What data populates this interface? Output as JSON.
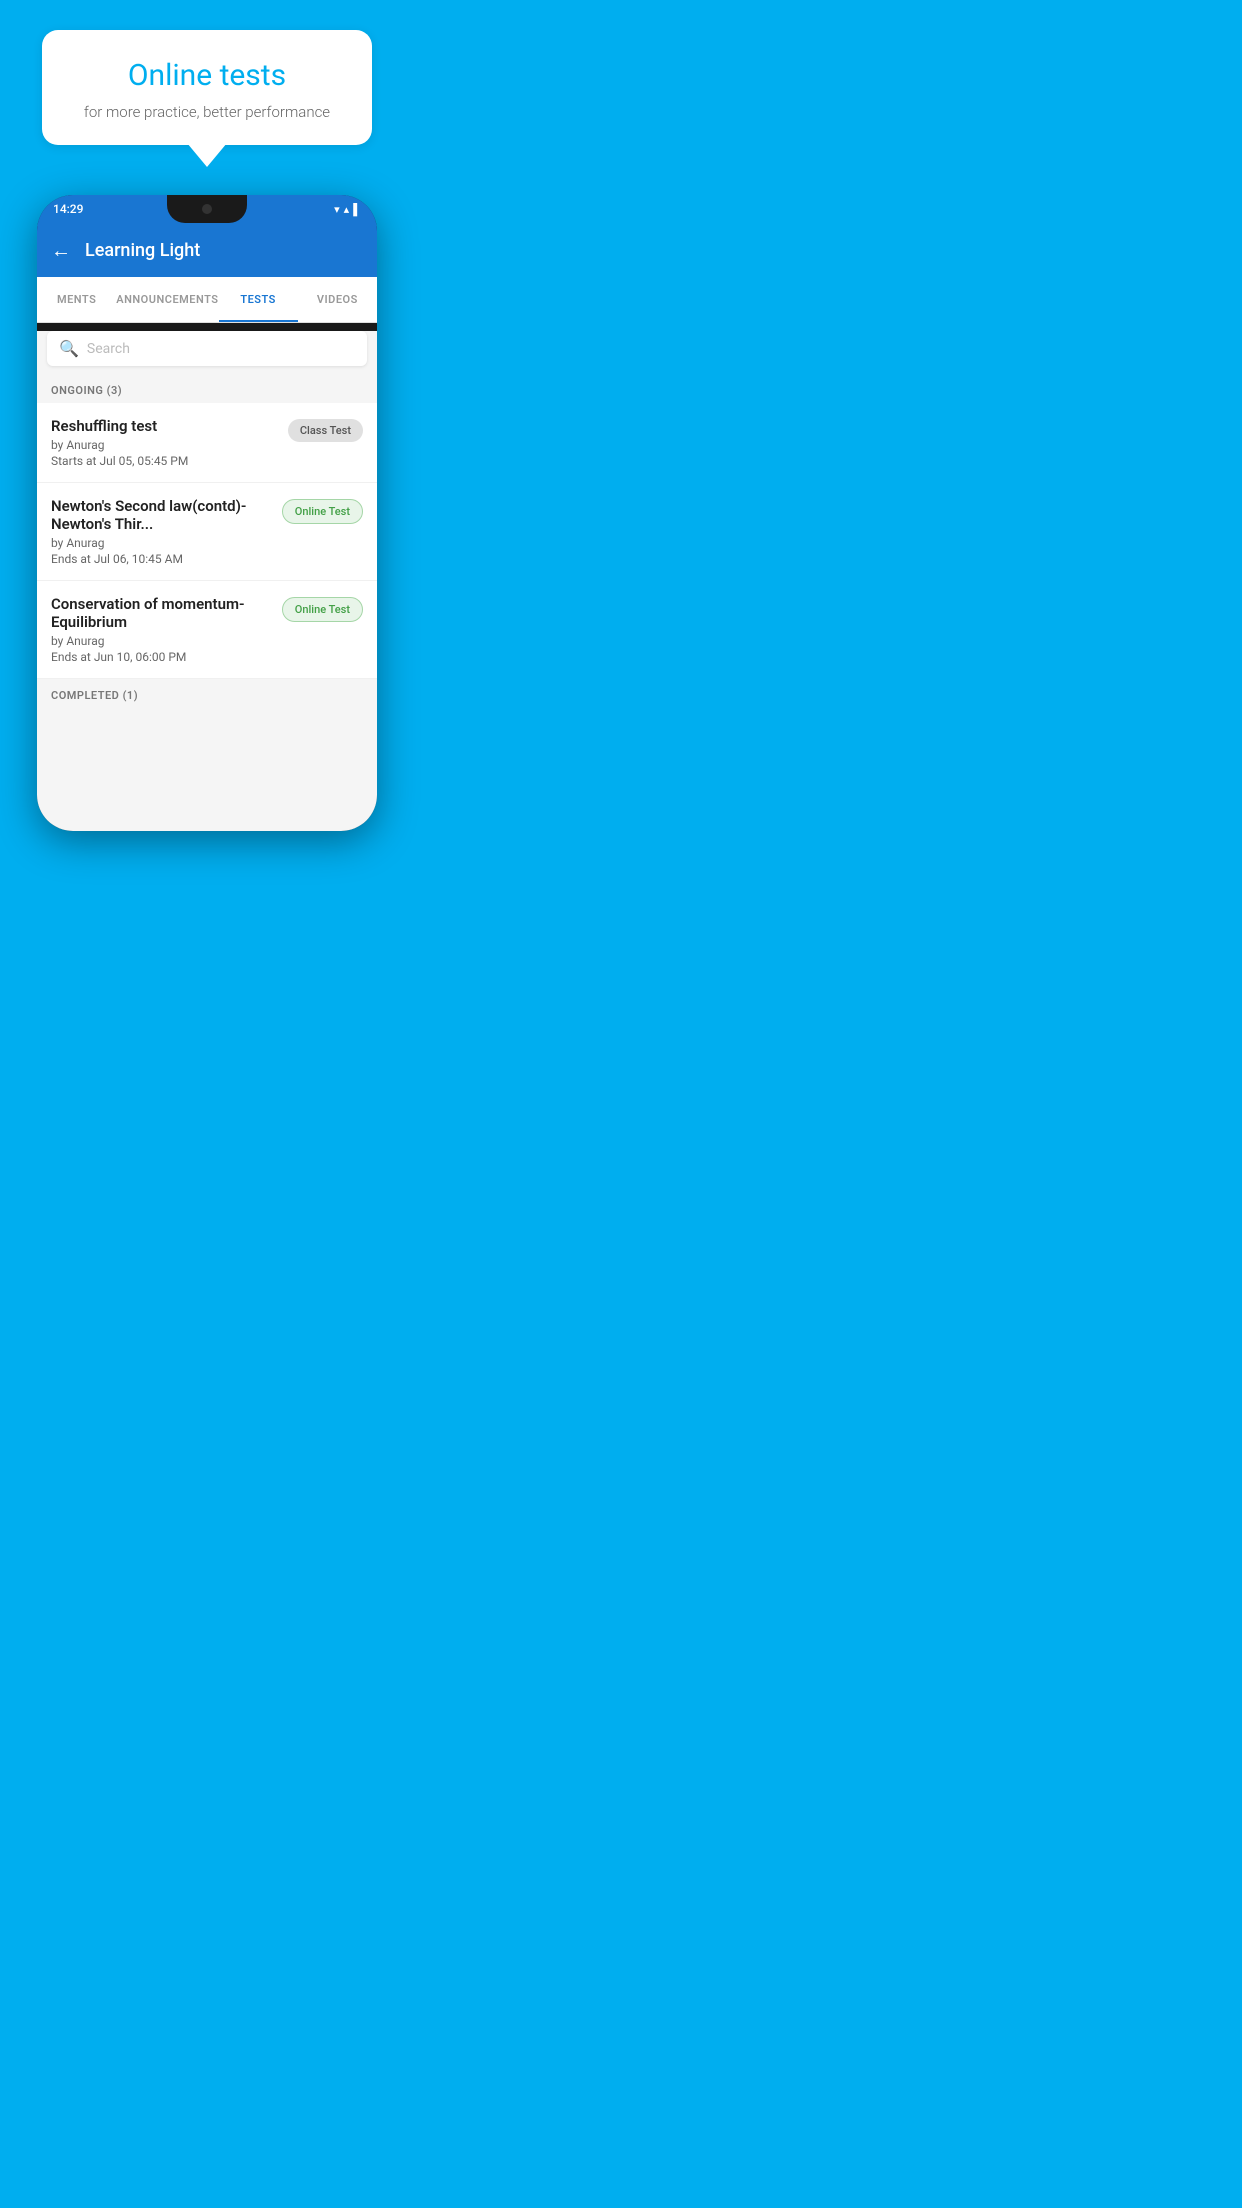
{
  "background": {
    "color": "#00AEEF"
  },
  "promo": {
    "title": "Online tests",
    "subtitle": "for more practice, better performance"
  },
  "phone": {
    "statusBar": {
      "time": "14:29",
      "icons": [
        "▼",
        "▲",
        "▌"
      ]
    },
    "appBar": {
      "title": "Learning Light",
      "backLabel": "←"
    },
    "tabs": [
      {
        "id": "ments",
        "label": "MENTS",
        "active": false
      },
      {
        "id": "announcements",
        "label": "ANNOUNCEMENTS",
        "active": false
      },
      {
        "id": "tests",
        "label": "TESTS",
        "active": true
      },
      {
        "id": "videos",
        "label": "VIDEOS",
        "active": false
      }
    ],
    "search": {
      "placeholder": "Search"
    },
    "ongoingSection": {
      "label": "ONGOING (3)"
    },
    "testItems": [
      {
        "id": "reshuffling",
        "name": "Reshuffling test",
        "by": "by Anurag",
        "date": "Starts at  Jul 05, 05:45 PM",
        "badgeLabel": "Class Test",
        "badgeType": "class"
      },
      {
        "id": "newtons-second",
        "name": "Newton's Second law(contd)-Newton's Thir...",
        "by": "by Anurag",
        "date": "Ends at  Jul 06, 10:45 AM",
        "badgeLabel": "Online Test",
        "badgeType": "online"
      },
      {
        "id": "conservation",
        "name": "Conservation of momentum-Equilibrium",
        "by": "by Anurag",
        "date": "Ends at  Jun 10, 06:00 PM",
        "badgeLabel": "Online Test",
        "badgeType": "online"
      }
    ],
    "completedSection": {
      "label": "COMPLETED (1)"
    }
  }
}
